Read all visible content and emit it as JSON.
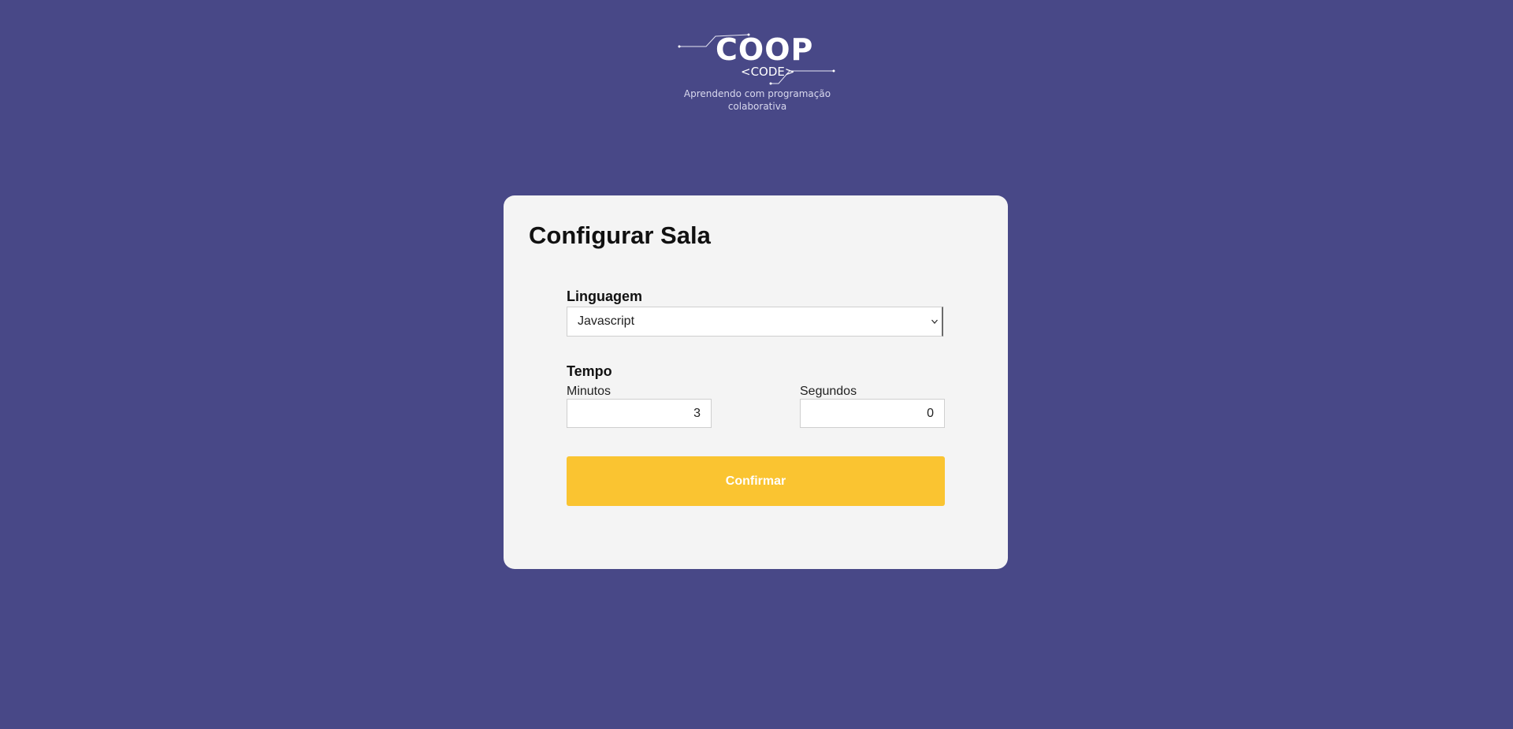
{
  "logo": {
    "title": "COOP",
    "subtitle": "<CODE>",
    "tagline": "Aprendendo com programação colaborativa"
  },
  "card": {
    "title": "Configurar Sala",
    "language": {
      "label": "Linguagem",
      "selected": "Javascript"
    },
    "time": {
      "label": "Tempo",
      "minutes": {
        "label": "Minutos",
        "value": "3"
      },
      "seconds": {
        "label": "Segundos",
        "value": "0"
      }
    },
    "confirm_label": "Confirmar"
  },
  "colors": {
    "background": "#484887",
    "card": "#f4f4f4",
    "accent": "#fac431"
  },
  "icons": {
    "select_arrow": "chevron-down-icon"
  }
}
